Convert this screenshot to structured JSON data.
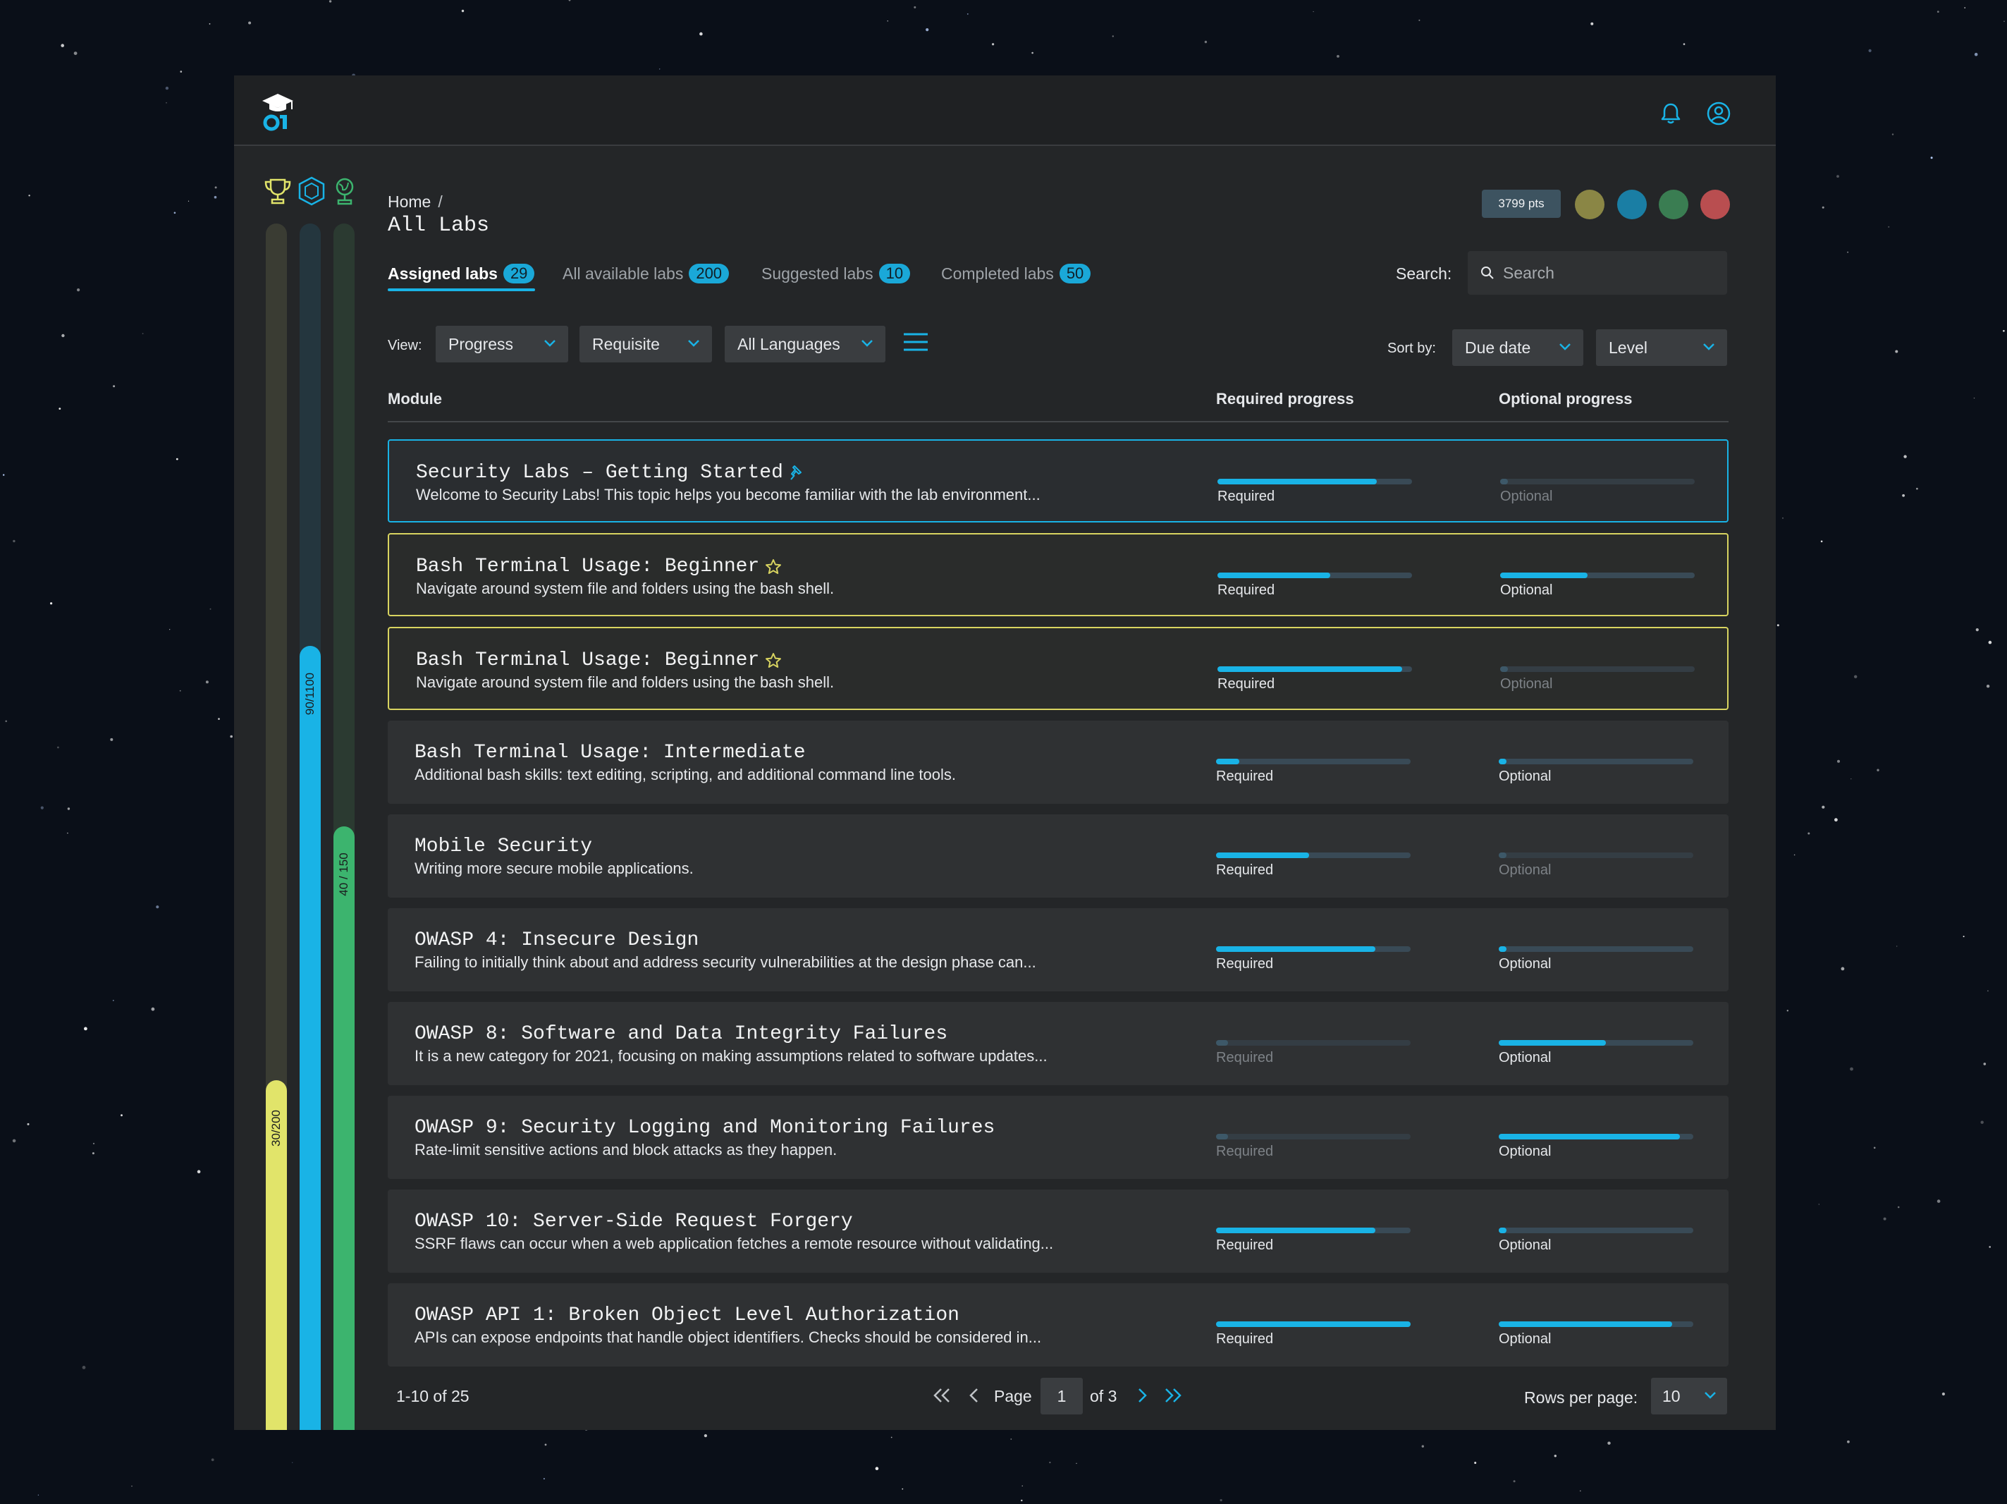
{
  "colors": {
    "accent": "#19b3e6",
    "yellow": "#e1e46a",
    "green": "#3cb46e",
    "favorite": "#d8d460"
  },
  "header": {
    "logo_icon": "graduation-cap-logo-icon",
    "notifications_icon": "bell-icon",
    "profile_icon": "user-circle-icon"
  },
  "levels": [
    {
      "icon": "trophy-icon",
      "label": "30/200",
      "progress": 0.29,
      "color": "#e1e46a",
      "track": "#3a3c33"
    },
    {
      "icon": "hexagon-badge-icon",
      "label": "90/1100",
      "progress": 0.65,
      "color": "#19b3e6",
      "track": "#24363e"
    },
    {
      "icon": "globe-stand-icon",
      "label": "40 / 150",
      "progress": 0.5,
      "color": "#3cb46e",
      "track": "#2b3a31"
    }
  ],
  "breadcrumb": {
    "home": "Home",
    "separator": "/"
  },
  "page": {
    "title": "All Labs"
  },
  "points": {
    "label": "3799 pts"
  },
  "status_dots": [
    "#8a8645",
    "#1a7ea4",
    "#3a7d52",
    "#b94e50"
  ],
  "tabs": [
    {
      "label": "Assigned labs",
      "count": "29",
      "active": true
    },
    {
      "label": "All available labs",
      "count": "200",
      "active": false
    },
    {
      "label": "Suggested labs",
      "count": "10",
      "active": false
    },
    {
      "label": "Completed labs",
      "count": "50",
      "active": false
    }
  ],
  "search": {
    "label": "Search:",
    "placeholder": "Search",
    "value": ""
  },
  "filters": {
    "view_label": "View:",
    "view": "Progress",
    "requisite": "Requisite",
    "language": "All Languages",
    "menu_icon": "hamburger-menu-icon",
    "sort_label": "Sort by:",
    "sort": "Due date",
    "level": "Level"
  },
  "table": {
    "columns": {
      "module": "Module",
      "required": "Required progress",
      "optional": "Optional progress"
    },
    "rows": [
      {
        "title": "Security Labs – Getting Started",
        "desc": "Welcome to Security Labs! This topic helps you become familiar with the lab environment...",
        "marker": "pin",
        "state": "selected",
        "required": 0.82,
        "optional": 0.04,
        "optional_active": false,
        "required_active": true,
        "req_label": "Required",
        "opt_label": "Optional"
      },
      {
        "title": "Bash Terminal Usage: Beginner",
        "desc": "Navigate around system file and folders using the bash shell.",
        "marker": "star",
        "state": "favorite",
        "required": 0.58,
        "optional": 0.45,
        "optional_active": true,
        "required_active": true,
        "req_label": "Required",
        "opt_label": "Optional"
      },
      {
        "title": "Bash Terminal Usage: Beginner",
        "desc": "Navigate around system file and folders using the bash shell.",
        "marker": "star",
        "state": "favorite",
        "required": 0.95,
        "optional": 0.04,
        "optional_active": false,
        "required_active": true,
        "req_label": "Required",
        "opt_label": "Optional"
      },
      {
        "title": "Bash Terminal Usage: Intermediate",
        "desc": "Additional bash skills: text editing, scripting, and additional command line tools.",
        "marker": "",
        "state": "",
        "required": 0.12,
        "optional": 0.04,
        "optional_active": true,
        "required_active": true,
        "req_label": "Required",
        "opt_label": "Optional"
      },
      {
        "title": "Mobile Security",
        "desc": "Writing more secure mobile applications.",
        "marker": "",
        "state": "",
        "required": 0.48,
        "optional": 0.04,
        "optional_active": false,
        "required_active": true,
        "req_label": "Required",
        "opt_label": "Optional"
      },
      {
        "title": "OWASP 4: Insecure Design",
        "desc": "Failing to initially think about and address security vulnerabilities at the design phase can...",
        "marker": "",
        "state": "",
        "required": 0.82,
        "optional": 0.04,
        "optional_active": true,
        "required_active": true,
        "req_label": "Required",
        "opt_label": "Optional"
      },
      {
        "title": "OWASP 8: Software and Data Integrity Failures",
        "desc": "It is a new category for 2021, focusing on making assumptions related to software updates...",
        "marker": "",
        "state": "",
        "required": 0.06,
        "optional": 0.55,
        "optional_active": true,
        "required_active": false,
        "req_label": "Required",
        "opt_label": "Optional"
      },
      {
        "title": "OWASP 9: Security Logging and Monitoring Failures",
        "desc": "Rate-limit sensitive actions and block attacks as they happen.",
        "marker": "",
        "state": "",
        "required": 0.06,
        "optional": 0.93,
        "optional_active": true,
        "required_active": false,
        "req_label": "Required",
        "opt_label": "Optional"
      },
      {
        "title": "OWASP 10: Server-Side Request Forgery",
        "desc": "SSRF flaws can occur when a web application fetches a remote resource without validating...",
        "marker": "",
        "state": "",
        "required": 0.82,
        "optional": 0.04,
        "optional_active": true,
        "required_active": true,
        "req_label": "Required",
        "opt_label": "Optional"
      },
      {
        "title": "OWASP API 1: Broken Object Level Authorization",
        "desc": "APIs can expose endpoints that handle object identifiers. Checks should be considered in...",
        "marker": "",
        "state": "",
        "required": 1.0,
        "optional": 0.89,
        "optional_active": true,
        "required_active": true,
        "req_label": "Required",
        "opt_label": "Optional"
      }
    ]
  },
  "pagination": {
    "range": "1-10 of 25",
    "page_label": "Page",
    "page": "1",
    "of": "of 3",
    "rows_label": "Rows per page:",
    "rows": "10"
  }
}
